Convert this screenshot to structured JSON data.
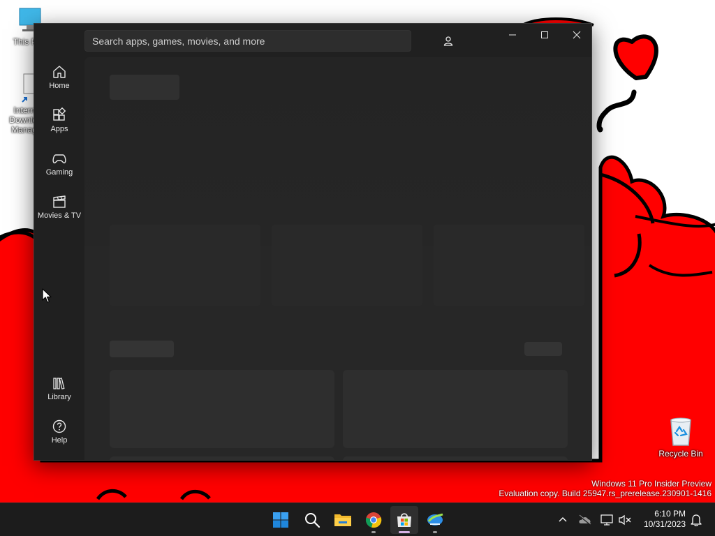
{
  "desktop": {
    "icons": [
      {
        "label": "This PC",
        "icon": "computer-icon"
      },
      {
        "label": "Internet Download Manager",
        "icon": "idm-shortcut-icon"
      },
      {
        "label": "Recycle Bin",
        "icon": "recycle-bin-icon"
      }
    ],
    "watermark": {
      "line1": "Windows 11 Pro Insider Preview",
      "line2": "Evaluation copy. Build 25947.rs_prerelease.230901-1416"
    },
    "wallpaper_colors": {
      "red": "#ff0000",
      "outline": "#000000"
    }
  },
  "store": {
    "search_placeholder": "Search apps, games, movies, and more",
    "account_icon": "account-icon",
    "window_controls": {
      "minimize": "minimize-icon",
      "maximize": "maximize-icon",
      "close": "close-icon"
    },
    "nav": [
      {
        "label": "Home",
        "icon": "home-icon"
      },
      {
        "label": "Apps",
        "icon": "apps-icon"
      },
      {
        "label": "Gaming",
        "icon": "gamepad-icon"
      },
      {
        "label": "Movies & TV",
        "icon": "clapperboard-icon"
      },
      {
        "label": "Library",
        "icon": "library-icon"
      },
      {
        "label": "Help",
        "icon": "help-icon"
      }
    ],
    "colors": {
      "background": "#202020",
      "content": "#272727",
      "skeleton": "#2f2f2f"
    }
  },
  "taskbar": {
    "apps": [
      {
        "name": "Start",
        "icon": "windows-start-icon"
      },
      {
        "name": "Search",
        "icon": "search-icon"
      },
      {
        "name": "File Explorer",
        "icon": "folder-icon"
      },
      {
        "name": "Google Chrome",
        "icon": "chrome-icon"
      },
      {
        "name": "Microsoft Store",
        "icon": "store-icon",
        "active": true
      },
      {
        "name": "Internet Download Manager",
        "icon": "idm-icon"
      }
    ],
    "tray": {
      "time": "6:10 PM",
      "date": "10/31/2023"
    },
    "accent": "#d8b2e6"
  }
}
